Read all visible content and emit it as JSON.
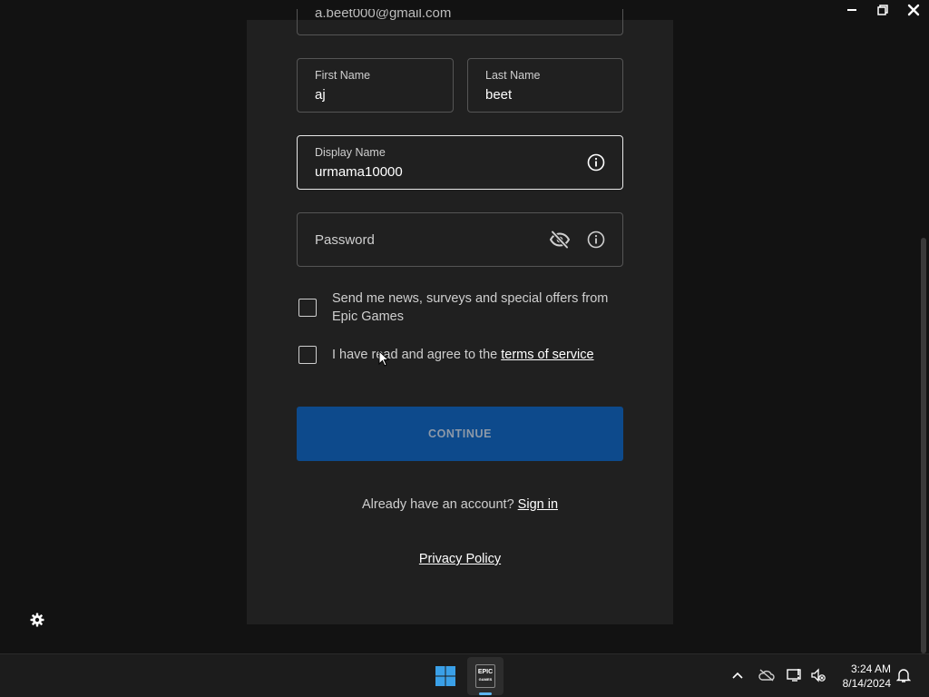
{
  "form": {
    "email_value": "a.beet000@gmail.com",
    "first_name": {
      "label": "First Name",
      "value": "aj"
    },
    "last_name": {
      "label": "Last Name",
      "value": "beet"
    },
    "display_name": {
      "label": "Display Name",
      "value": "urmama10000"
    },
    "password": {
      "placeholder": "Password"
    },
    "news_checkbox": {
      "text": "Send me news, surveys and special offers from Epic Games",
      "checked": false
    },
    "terms_checkbox": {
      "text_prefix": "I have read and agree to the ",
      "link": "terms of service",
      "checked": false
    },
    "continue_label": "CONTINUE",
    "already_text": "Already have an account? ",
    "sign_in_link": "Sign in",
    "privacy_link": "Privacy Policy"
  },
  "icons": {
    "info": "info-icon",
    "eye_off": "eye-off-icon",
    "settings": "gear-icon"
  },
  "taskbar": {
    "epic_label_line1": "EPIC",
    "epic_label_line2": "GAMES",
    "time": "3:24 AM",
    "date": "8/14/2024"
  },
  "colors": {
    "continue_bg": "#0d4a8c",
    "panel_bg": "#202020",
    "page_bg": "#121212"
  }
}
